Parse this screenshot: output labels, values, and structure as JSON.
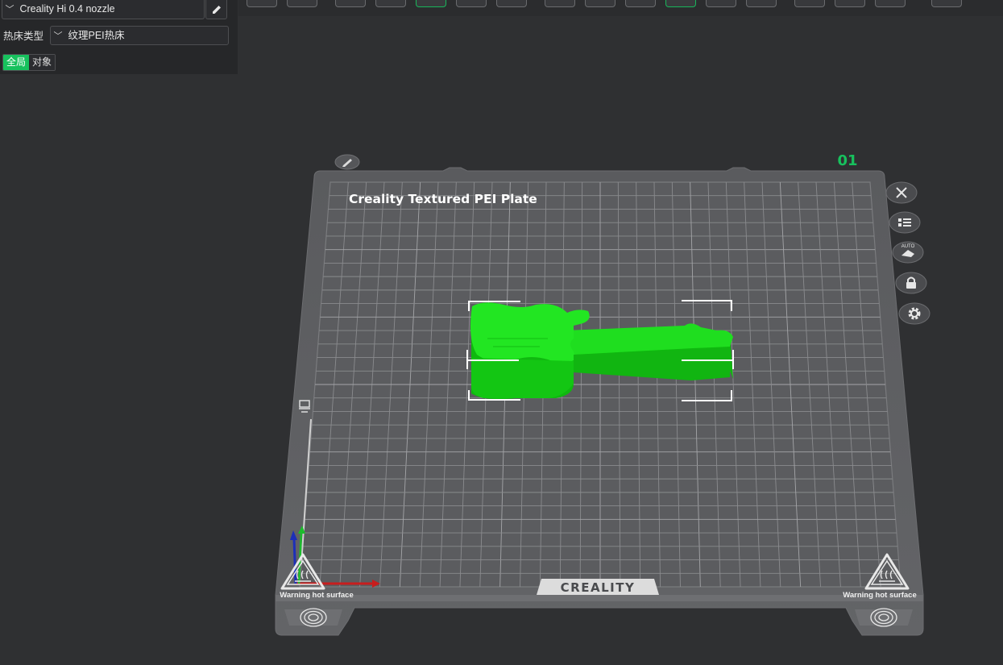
{
  "printer": {
    "name": "Creality Hi 0.4 nozzle",
    "edit_icon": "pencil-icon"
  },
  "bed": {
    "label": "热床类型",
    "value": "纹理PEI热床"
  },
  "scope_tabs": [
    {
      "label": "全局",
      "active": true
    },
    {
      "label": "对象",
      "active": false
    }
  ],
  "plate": {
    "title": "Creality Textured PEI Plate",
    "brand": "CREALITY",
    "warning_left": "Warning hot surface",
    "warning_right": "Warning hot surface",
    "plate_number": "01"
  },
  "side_tools": [
    {
      "name": "close-plate",
      "icon": "close-icon"
    },
    {
      "name": "arrange-list",
      "icon": "list-icon"
    },
    {
      "name": "auto-orient",
      "icon": "auto-arrange-icon",
      "caption": "AUTO"
    },
    {
      "name": "lock-plate",
      "icon": "lock-icon"
    },
    {
      "name": "plate-settings",
      "icon": "gear-icon"
    }
  ],
  "colors": {
    "accent": "#17c15d",
    "model": "#1cd61c",
    "plate": "#5d5e61",
    "background": "#2f3032"
  }
}
